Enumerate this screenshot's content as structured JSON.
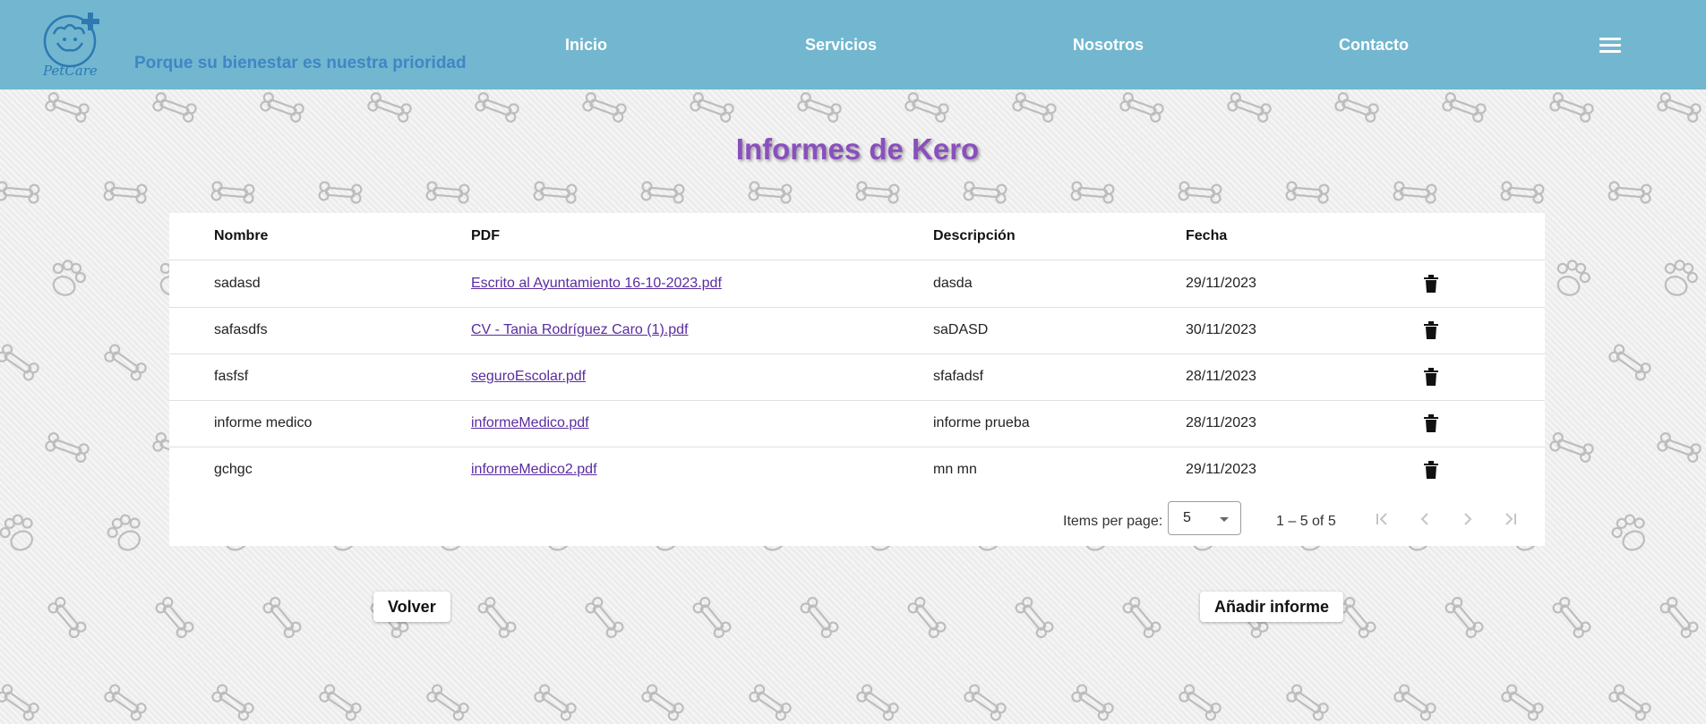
{
  "brand": {
    "logo_text": "PetCare",
    "tagline": "Porque su bienestar es nuestra prioridad"
  },
  "nav": {
    "items": [
      "Inicio",
      "Servicios",
      "Nosotros",
      "Contacto"
    ],
    "menu_icon": "hamburger-menu-icon"
  },
  "page_title": "Informes de Kero",
  "table": {
    "headers": {
      "nombre": "Nombre",
      "pdf": "PDF",
      "descripcion": "Descripción",
      "fecha": "Fecha"
    },
    "rows": [
      {
        "nombre": "sadasd",
        "pdf": "Escrito al Ayuntamiento 16-10-2023.pdf",
        "descripcion": "dasda",
        "fecha": "29/11/2023"
      },
      {
        "nombre": "safasdfs",
        "pdf": "CV - Tania Rodríguez Caro (1).pdf",
        "descripcion": "saDASD",
        "fecha": "30/11/2023"
      },
      {
        "nombre": "fasfsf",
        "pdf": "seguroEscolar.pdf",
        "descripcion": "sfafadsf",
        "fecha": "28/11/2023"
      },
      {
        "nombre": "informe medico",
        "pdf": "informeMedico.pdf",
        "descripcion": "informe prueba",
        "fecha": "28/11/2023"
      },
      {
        "nombre": "gchgc",
        "pdf": "informeMedico2.pdf",
        "descripcion": "mn mn",
        "fecha": "29/11/2023"
      }
    ]
  },
  "paginator": {
    "items_per_page_label": "Items per page:",
    "page_size": "5",
    "range": "1 – 5 of 5"
  },
  "buttons": {
    "back": "Volver",
    "add": "Añadir informe"
  },
  "colors": {
    "header_bg": "#72b7cf",
    "title": "#8a4fbe",
    "tagline": "#3f86c6",
    "link": "#5a2ca0"
  }
}
